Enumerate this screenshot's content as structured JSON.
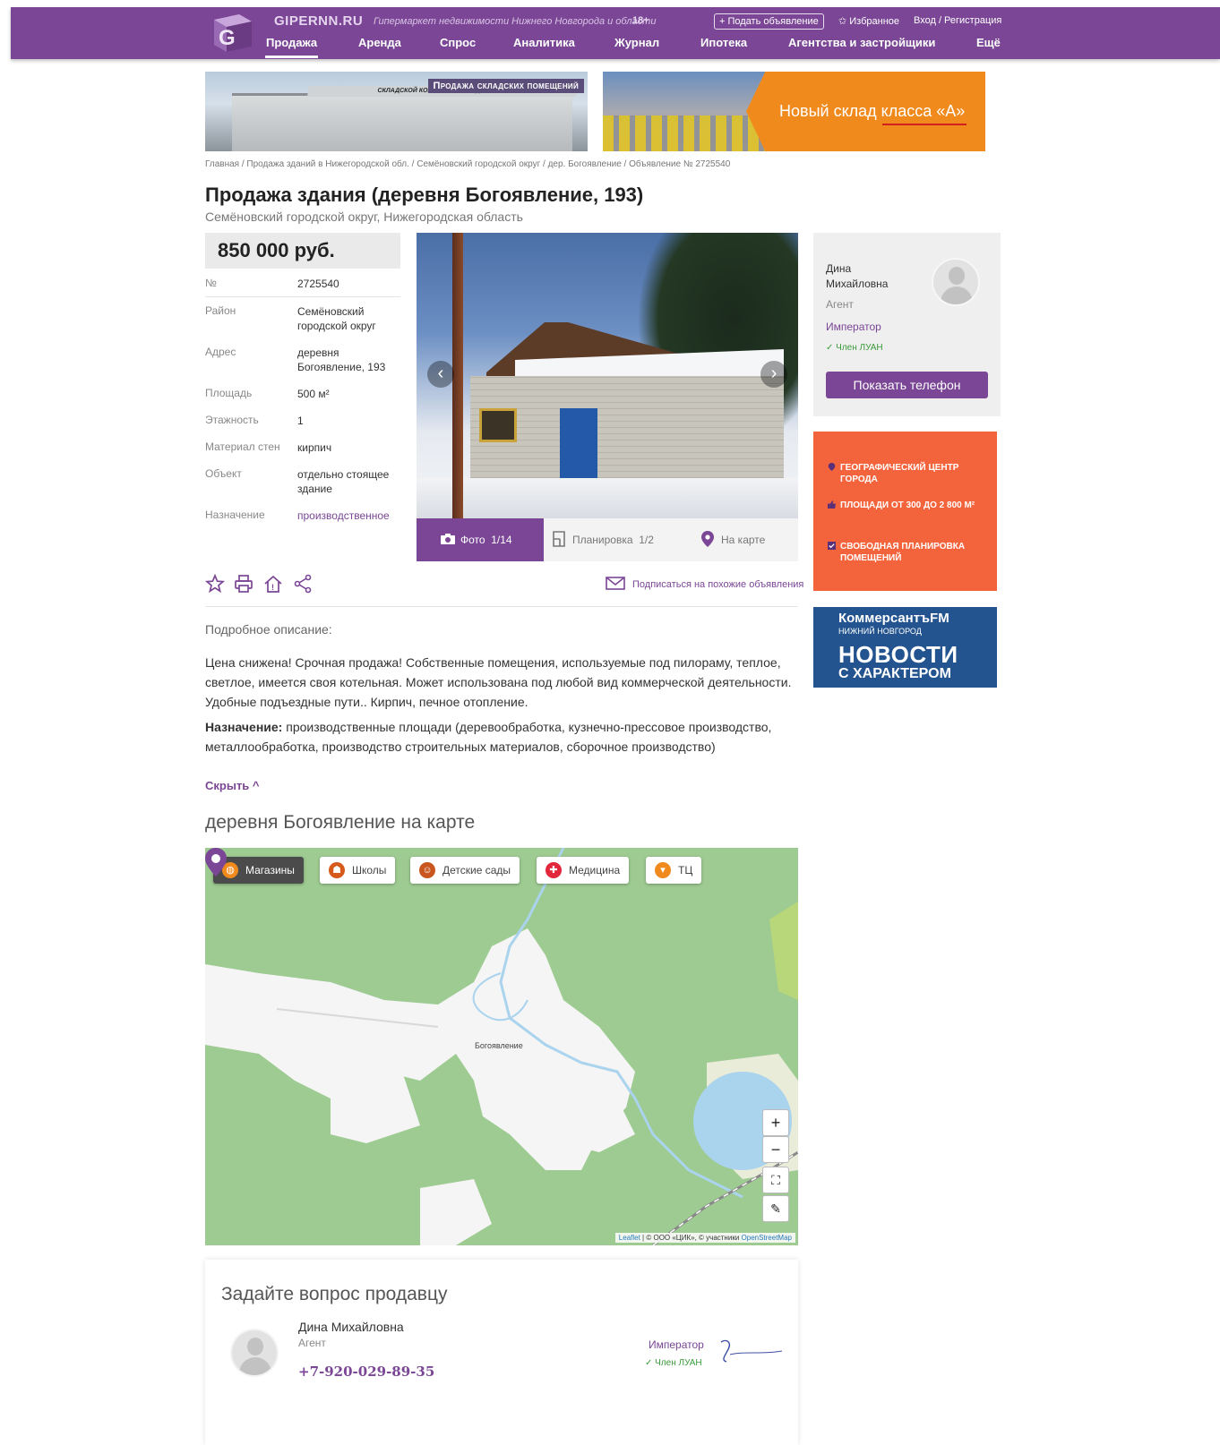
{
  "header": {
    "brand": "GIPERNN.RU",
    "tagline": "Гипермаркет недвижимости Нижнего Новгорода и области",
    "age": "18+",
    "post_button": "+ Подать объявление",
    "favorites": "✩ Избранное",
    "login": "Вход / Регистрация",
    "nav": [
      "Продажа",
      "Аренда",
      "Спрос",
      "Аналитика",
      "Журнал",
      "Ипотека",
      "Агентства и застройщики",
      "Ещё"
    ]
  },
  "banners": {
    "left_title": "Продажа складских помещений",
    "left_strip": "СКЛАДСКОЙ КОМПЛЕКС НА РОДИОНОВА",
    "right_text": "Новый склад класса «А»"
  },
  "breadcrumb": "Главная / Продажа зданий в Нижегородской обл. / Семёновский городской округ / дер. Богоявление / Объявление № 2725540",
  "listing": {
    "title": "Продажа здания (деревня Богоявление, 193)",
    "subtitle": "Семёновский городской округ, Нижегородская область",
    "price": "850 000 руб.",
    "props": [
      {
        "key": "№",
        "value": "2725540"
      },
      {
        "key": "Район",
        "value": "Семёновский городской округ"
      },
      {
        "key": "Адрес",
        "value": "деревня Богоявление, 193"
      },
      {
        "key": "Площадь",
        "value": "500 м²"
      },
      {
        "key": "Этажность",
        "value": "1"
      },
      {
        "key": "Материал стен",
        "value": "кирпич"
      },
      {
        "key": "Объект",
        "value": "отдельно стоящее здание"
      },
      {
        "key": "Назначение",
        "value": "производственное"
      }
    ]
  },
  "photo_tabs": {
    "photo": "Фото",
    "photo_count": "1/14",
    "plan": "Планировка",
    "plan_count": "1/2",
    "map": "На карте"
  },
  "agent": {
    "name": "Дина Михайловна",
    "role": "Агент",
    "company": "Император",
    "luan": "✓ Член ЛУАН",
    "show_phone": "Показать телефон"
  },
  "promo": {
    "items": [
      "ГЕОГРАФИЧЕСКИЙ ЦЕНТР ГОРОДА",
      "ПЛОЩАДИ ОТ 300 ДО 2 800 М²",
      "СВОБОДНАЯ ПЛАНИРОВКА ПОМЕЩЕНИЙ"
    ]
  },
  "kfm": {
    "brand": "КоммерсантъFM",
    "city": "НИЖНИЙ НОВГОРОД",
    "line1": "НОВОСТИ",
    "line2": "С ХАРАКТЕРОМ"
  },
  "actions": {
    "subscribe": "Подписаться на похожие объявления"
  },
  "description": {
    "heading": "Подробное описание:",
    "text": "Цена снижена! Срочная продажа! Собственные помещения, используемые под пилораму, теплое, светлое, имеется своя котельная. Может использована под любой вид коммерческой деятельности. Удобные подъездные пути.. Кирпич, печное отопление.",
    "purpose_label": "Назначение:",
    "purpose_text": " производственные площади (деревообработка, кузнечно-прессовое производство, металлообработка, производство строительных материалов, сборочное производство)",
    "hide": "Скрыть ^"
  },
  "map": {
    "heading": "деревня Богоявление на карте",
    "chips": [
      "Магазины",
      "Школы",
      "Детские сады",
      "Медицина",
      "ТЦ"
    ],
    "place": "Богоявление",
    "attribution_leaflet": "Leaflet",
    "attribution_mid": " | © ООО «ЦИК», © участники ",
    "attribution_osm": "OpenStreetMap",
    "colors": {
      "forest": "#9ecb92",
      "open": "#f5f5f5",
      "water": "#aad3ee",
      "accent": "#7a4695"
    }
  },
  "ask": {
    "heading": "Задайте вопрос продавцу",
    "name": "Дина Михайловна",
    "role": "Агент",
    "phone": "+7-920-029-89-35",
    "company": "Император",
    "luan": "✓ Член ЛУАН",
    "logo_text": "Император"
  }
}
